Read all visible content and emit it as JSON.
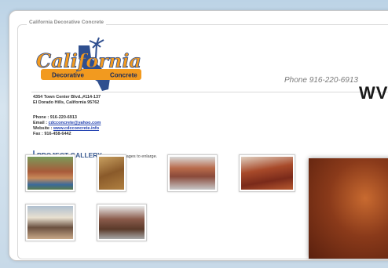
{
  "page": {
    "legend": "California Decorative Concrete",
    "phone_right": "Phone 916-220-6913",
    "www_fragment": "WV"
  },
  "logo": {
    "script_text": "California",
    "band_left": "Decorative",
    "band_right": "Concrete"
  },
  "address": {
    "line1": "4354 Town Center Blvd.,#114-137",
    "line2": "El Dorado Hills, California 95762"
  },
  "contact": {
    "phone": "Phone : 916-220-6913",
    "email_label": "Email : ",
    "email": "cdcconcrete@yahoo.com",
    "website_label": "Website : ",
    "website": "www.cdcconcrete.info",
    "fax": "Fax : 916-458-6442"
  },
  "gallery": {
    "title": "PROJECT GALLERY",
    "note": "Click on images to enlarge."
  },
  "colors": {
    "accent_blue": "#3a5a90",
    "logo_orange": "#f29a1f",
    "link_blue": "#2040b0"
  }
}
